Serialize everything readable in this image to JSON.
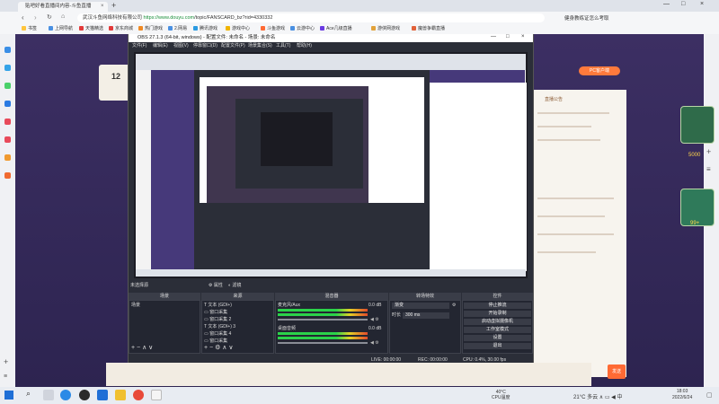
{
  "browser": {
    "tab_title": "贴吧好看直播间内容-斗鱼直播",
    "tab_close": "×",
    "new_tab": "+",
    "url_prefix": "武汉斗鱼网络科技有限公司",
    "url_host": "https://www.douyu.com",
    "url_path": "/topic/FANSCARD_bz?rid=4330332",
    "search_hint": "健身教练证怎么考取",
    "bookmarks": [
      "书签",
      "上网导航",
      "天猫精选",
      "京东商城",
      "热门游戏",
      "2.网易",
      "腾讯游戏",
      "游戏中心",
      "斗鱼游戏",
      "云游中心",
      "Ace几级直播",
      "游侠网游戏",
      "魔兽争霸直播"
    ],
    "window_buttons": [
      "—",
      "□",
      "×"
    ]
  },
  "page": {
    "left_card_number": "12",
    "pc_button": "PC客户端",
    "notice_label": "直播公告",
    "right_badge_1_text": "5000",
    "right_badge_2_text": "99+",
    "send_label": "发送",
    "accent": "#ff7a3c"
  },
  "obs": {
    "title": "OBS 27.1.3 (64-bit, windows) - 配置文件: 未命名 - 场景: 未命名",
    "menu": [
      "文件(F)",
      "编辑(E)",
      "视图(V)",
      "停靠窗口(D)",
      "配置文件(P)",
      "场景集合(S)",
      "工具(T)",
      "帮助(H)"
    ],
    "scene_info": "未选择源",
    "properties_btn": "属性",
    "filters_btn": "滤镜",
    "docks": {
      "scenes": {
        "title": "场景",
        "items": [
          "场景"
        ]
      },
      "sources": {
        "title": "来源",
        "items": [
          "文本 (GDI+)",
          "窗口采集",
          "窗口采集 2",
          "文本 (GDI+) 3",
          "窗口采集 4",
          "窗口采集"
        ]
      },
      "mixer": {
        "title": "混音器",
        "tracks": [
          {
            "name": "麦克风/Aux",
            "db": "0.0 dB"
          },
          {
            "name": "桌面音频",
            "db": "0.0 dB"
          }
        ]
      },
      "transitions": {
        "title": "转场特效",
        "type": "渐变",
        "duration_label": "时长",
        "duration": "300 ms"
      },
      "controls": {
        "title": "控件",
        "buttons": [
          "停止推流",
          "开始录制",
          "启动虚拟摄像机",
          "工作室模式",
          "设置",
          "退出"
        ]
      }
    },
    "status": {
      "live": "LIVE: 00:00:00",
      "rec": "REC: 00:00:00",
      "cpu": "CPU: 0.4%, 30.00 fps"
    }
  },
  "taskbar": {
    "weather_temp": "40°C",
    "weather_label": "CPU温度",
    "tray_temp": "21°C 多云",
    "tray_lang": "中",
    "time": "18:03",
    "date": "2022/6/24"
  }
}
